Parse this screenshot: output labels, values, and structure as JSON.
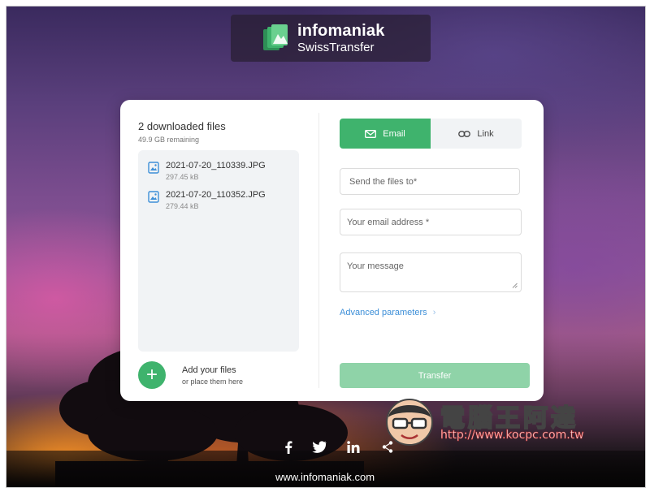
{
  "brand": {
    "name": "infomaniak",
    "product": "SwissTransfer"
  },
  "files_panel": {
    "title": "2 downloaded files",
    "remaining": "49.9 GB remaining",
    "files": [
      {
        "name": "2021-07-20_110339.JPG",
        "size": "297.45 kB"
      },
      {
        "name": "2021-07-20_110352.JPG",
        "size": "279.44 kB"
      }
    ],
    "add_label": "Add your files",
    "add_sub": "or place them here"
  },
  "tabs": {
    "email": "Email",
    "link": "Link",
    "active": "email"
  },
  "form": {
    "send_to_placeholder": "Send the files to*",
    "email_placeholder": "Your email address *",
    "message_placeholder": "Your message",
    "advanced": "Advanced parameters",
    "transfer": "Transfer"
  },
  "footer": {
    "url": "www.infomaniak.com",
    "social": [
      "facebook-icon",
      "twitter-icon",
      "linkedin-icon",
      "share-icon"
    ]
  },
  "watermark": {
    "text": "電腦王阿達",
    "url": "http://www.kocpc.com.tw"
  },
  "colors": {
    "accent": "#3fb36d",
    "accent_disabled": "#8fd3a8",
    "link": "#3d8fd8"
  }
}
